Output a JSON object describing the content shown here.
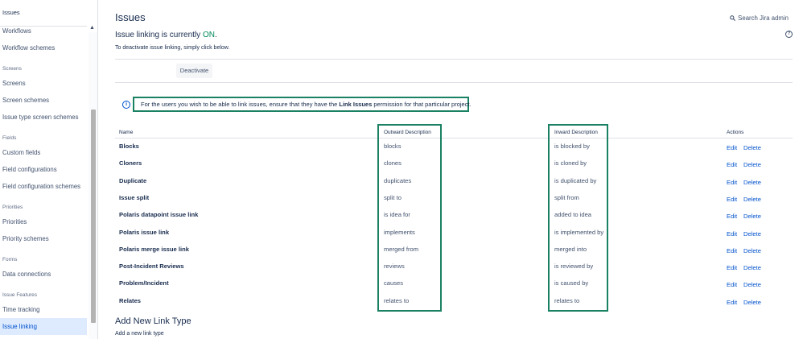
{
  "sidebar": {
    "title": "Issues",
    "items": {
      "workflows": "Workflows",
      "workflow_schemes": "Workflow schemes",
      "screens_head": "Screens",
      "screens": "Screens",
      "screen_schemes": "Screen schemes",
      "issue_type_screen_schemes": "Issue type screen schemes",
      "fields_head": "Fields",
      "custom_fields": "Custom fields",
      "field_configurations": "Field configurations",
      "field_configuration_schemes": "Field configuration schemes",
      "priorities_head": "Priorities",
      "priorities": "Priorities",
      "priority_schemes": "Priority schemes",
      "forms_head": "Forms",
      "data_connections": "Data connections",
      "issue_features_head": "Issue Features",
      "time_tracking": "Time tracking",
      "issue_linking": "Issue linking"
    }
  },
  "header": {
    "title": "Issues",
    "search": "Search Jira admin"
  },
  "status": {
    "prefix": "Issue linking is currently ",
    "state": "ON",
    "suffix": ".",
    "hint": "To deactivate issue linking, simply click below.",
    "button": "Deactivate"
  },
  "info": {
    "text_before": "For the users you wish to be able to link issues, ensure that they have the ",
    "bold": "Link Issues",
    "text_after": " permission for that particular project."
  },
  "table": {
    "headers": {
      "name": "Name",
      "outward": "Outward Description",
      "inward": "Inward Description",
      "actions": "Actions"
    },
    "edit_label": "Edit",
    "delete_label": "Delete",
    "rows": [
      {
        "name": "Blocks",
        "outward": "blocks",
        "inward": "is blocked by"
      },
      {
        "name": "Cloners",
        "outward": "clones",
        "inward": "is cloned by"
      },
      {
        "name": "Duplicate",
        "outward": "duplicates",
        "inward": "is duplicated by"
      },
      {
        "name": "Issue split",
        "outward": "split to",
        "inward": "split from"
      },
      {
        "name": "Polaris datapoint issue link",
        "outward": "is idea for",
        "inward": "added to idea"
      },
      {
        "name": "Polaris issue link",
        "outward": "implements",
        "inward": "is implemented by"
      },
      {
        "name": "Polaris merge issue link",
        "outward": "merged from",
        "inward": "merged into"
      },
      {
        "name": "Post-Incident Reviews",
        "outward": "reviews",
        "inward": "is reviewed by"
      },
      {
        "name": "Problem/Incident",
        "outward": "causes",
        "inward": "is caused by"
      },
      {
        "name": "Relates",
        "outward": "relates to",
        "inward": "relates to"
      }
    ]
  },
  "add_section": {
    "title": "Add New Link Type",
    "subtitle": "Add a new link type"
  }
}
